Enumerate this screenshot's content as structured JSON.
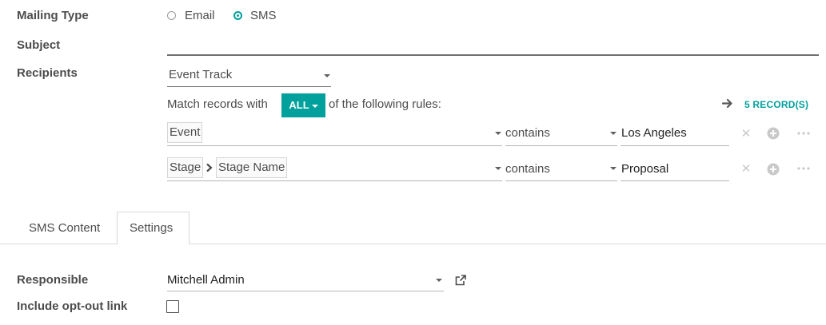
{
  "mailing_type": {
    "label": "Mailing Type",
    "options": [
      {
        "label": "Email",
        "checked": false
      },
      {
        "label": "SMS",
        "checked": true
      }
    ]
  },
  "subject": {
    "label": "Subject",
    "value": ""
  },
  "recipients": {
    "label": "Recipients",
    "model": "Event Track",
    "match_prefix": "Match records with",
    "match_mode": "ALL",
    "match_suffix": "of the following rules:",
    "records_count": "5 RECORD(S)",
    "rules": [
      {
        "path": [
          "Event"
        ],
        "operator": "contains",
        "value": "Los Angeles"
      },
      {
        "path": [
          "Stage",
          "Stage Name"
        ],
        "operator": "contains",
        "value": "Proposal"
      }
    ]
  },
  "tabs": [
    {
      "label": "SMS Content",
      "active": false
    },
    {
      "label": "Settings",
      "active": true
    }
  ],
  "settings": {
    "responsible_label": "Responsible",
    "responsible_value": "Mitchell Admin",
    "optout_label": "Include opt-out link",
    "optout_checked": false
  },
  "colors": {
    "accent": "#00a09d",
    "text": "#4c4c4c",
    "muted": "#c9c9c9"
  },
  "icons": [
    "radio-icon",
    "arrow-right-icon",
    "caret-down-icon",
    "delete-icon",
    "add-icon",
    "more-icon",
    "external-link-icon"
  ]
}
